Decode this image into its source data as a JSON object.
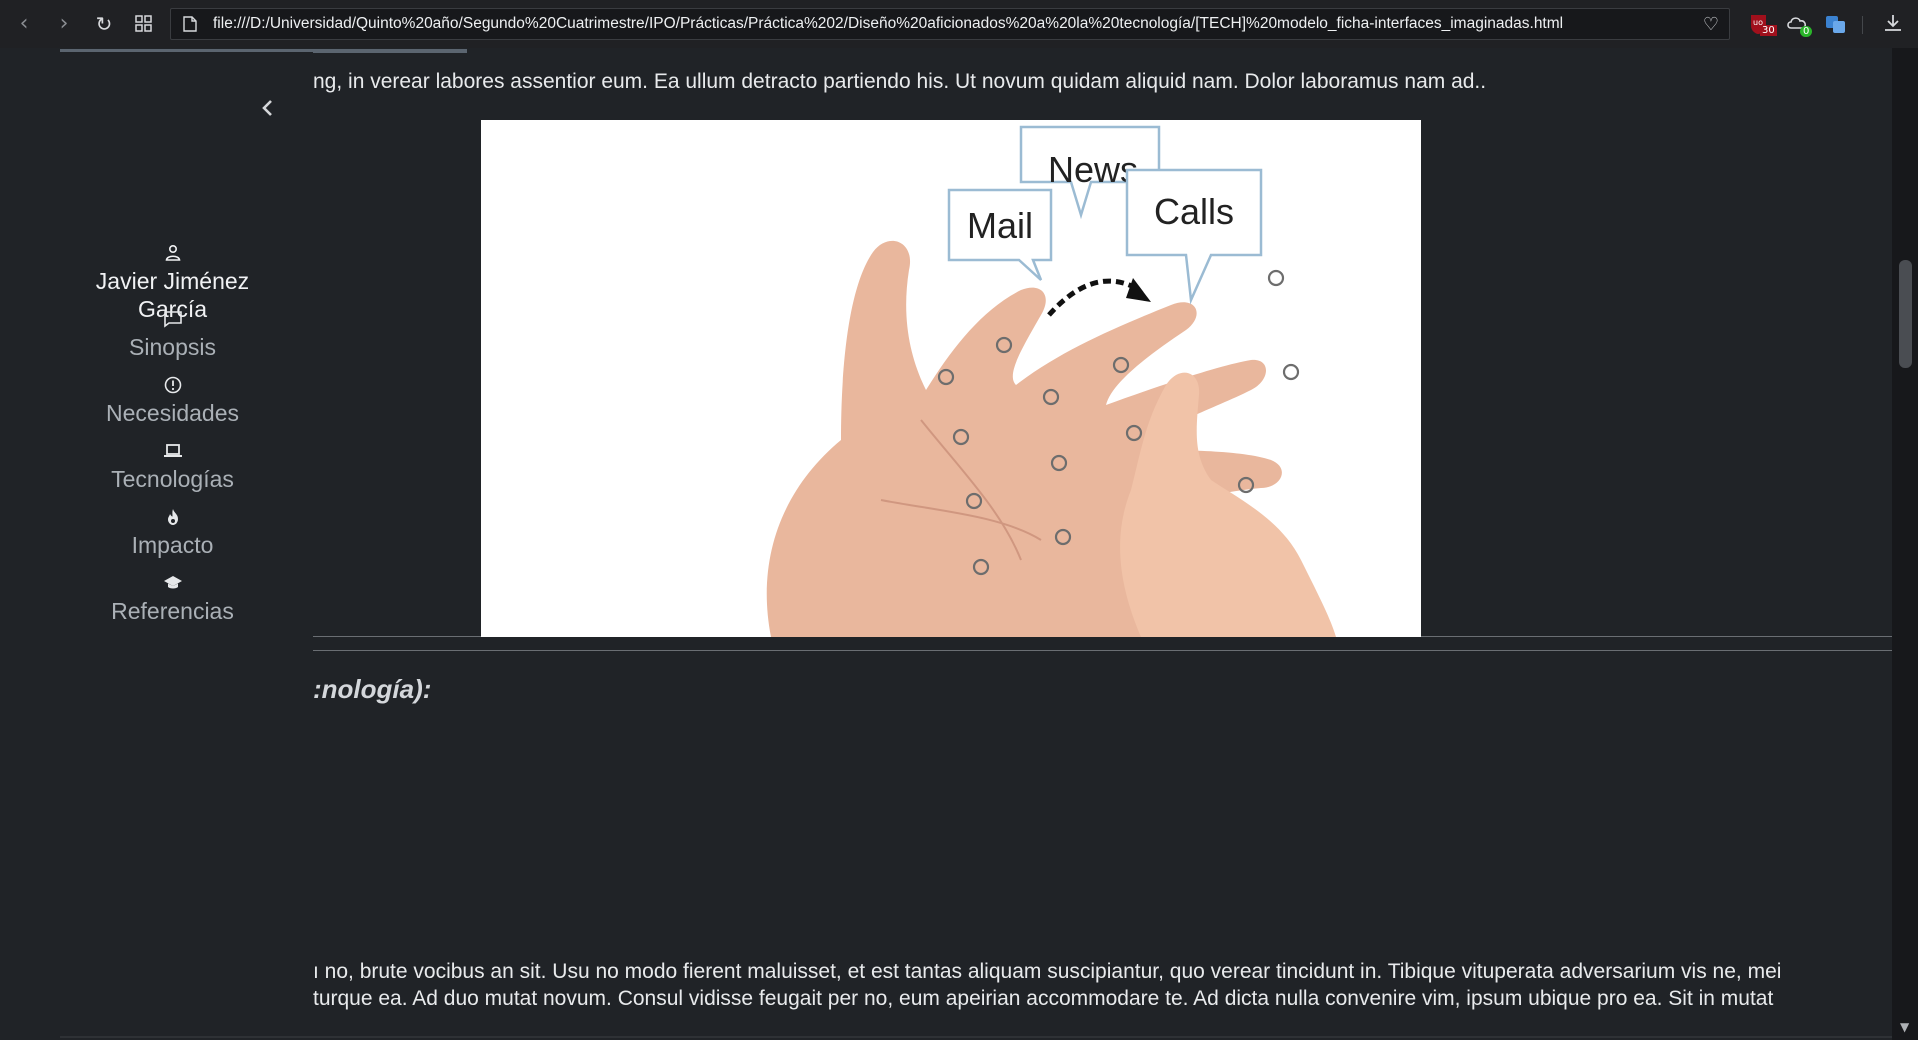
{
  "browser": {
    "url": "file:///D:/Universidad/Quinto%20año/Segundo%20Cuatrimestre/IPO/Prácticas/Práctica%202/Diseño%20aficionados%20a%20la%20tecnología/[TECH]%20modelo_ficha-interfaces_imaginadas.html",
    "extension_badges": {
      "ublock": "30",
      "privacy": "0"
    }
  },
  "sidebar": {
    "user": {
      "icon": "person-icon",
      "label": "Javier Jiménez García"
    },
    "items": [
      {
        "icon": "chat-icon",
        "label": "Sinopsis"
      },
      {
        "icon": "alert-circle-icon",
        "label": "Necesidades"
      },
      {
        "icon": "laptop-icon",
        "label": "Tecnologías"
      },
      {
        "icon": "fire-icon",
        "label": "Impacto"
      },
      {
        "icon": "graduation-cap-icon",
        "label": "Referencias"
      }
    ]
  },
  "main": {
    "paragraph_top": "ng, in verear labores assentior eum. Ea ullum detracto partiendo his. Ut novum quidam aliquid nam. Dolor laboramus nam ad..",
    "image": {
      "bubbles": [
        "Mail",
        "News",
        "Calls"
      ]
    },
    "section_heading": ":nología):",
    "paragraph_bottom": [
      "ı no, brute vocibus an sit. Usu no modo fierent maluisset, et est tantas aliquam suscipiantur, quo verear tincidunt in. Tibique vituperata adversarium vis ne, mei",
      "turque ea. Ad duo mutat novum. Consul vidisse feugait per no, eum apeirian accommodare te. Ad dicta nulla convenire vim, ipsum ubique pro ea. Sit in mutat"
    ]
  },
  "colors": {
    "background": "#202327",
    "chrome": "#202124",
    "text": "#e8eaec",
    "muted_text": "#aab0b6"
  }
}
